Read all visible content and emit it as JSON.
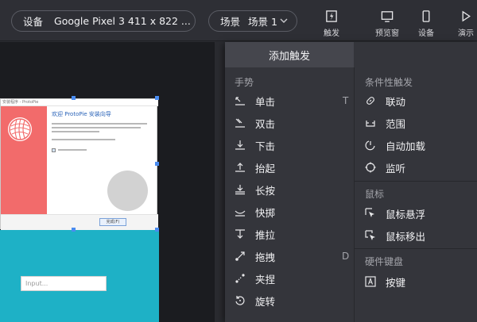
{
  "toolbar": {
    "device_label": "设备",
    "device_value": "Google Pixel 3  411 x 822 ...",
    "scene_label": "场景",
    "scene_value": "场景 1",
    "trigger_btn": "触发",
    "preview_btn": "预览窗",
    "device_btn": "设备",
    "play_btn": "演示"
  },
  "canvas": {
    "dialog_title": "安装程序 - ProtoPie",
    "dialog_heading": "欢迎 ProtoPie 安装向导",
    "dialog_ok": "完成(F)",
    "input_placeholder": "Input..."
  },
  "menu": {
    "header": "添加触发",
    "gestures": {
      "title": "手势",
      "items": [
        {
          "label": "单击",
          "icon": "tap-icon",
          "shortcut": "T"
        },
        {
          "label": "双击",
          "icon": "double-tap-icon",
          "shortcut": ""
        },
        {
          "label": "下击",
          "icon": "touch-down-icon",
          "shortcut": ""
        },
        {
          "label": "抬起",
          "icon": "touch-up-icon",
          "shortcut": ""
        },
        {
          "label": "长按",
          "icon": "long-press-icon",
          "shortcut": ""
        },
        {
          "label": "快掷",
          "icon": "fling-icon",
          "shortcut": ""
        },
        {
          "label": "推拉",
          "icon": "pull-icon",
          "shortcut": ""
        },
        {
          "label": "拖拽",
          "icon": "drag-icon",
          "shortcut": "D"
        },
        {
          "label": "夹捏",
          "icon": "pinch-icon",
          "shortcut": ""
        },
        {
          "label": "旋转",
          "icon": "rotate-icon",
          "shortcut": ""
        }
      ]
    },
    "conditional": {
      "title": "条件性触发",
      "items": [
        {
          "label": "联动",
          "icon": "link-icon"
        },
        {
          "label": "范围",
          "icon": "range-icon"
        },
        {
          "label": "自动加载",
          "icon": "auto-load-icon"
        },
        {
          "label": "监听",
          "icon": "listen-icon"
        }
      ]
    },
    "mouse": {
      "title": "鼠标",
      "items": [
        {
          "label": "鼠标悬浮",
          "icon": "mouse-hover-icon"
        },
        {
          "label": "鼠标移出",
          "icon": "mouse-out-icon"
        }
      ]
    },
    "keyboard": {
      "title": "硬件键盘",
      "items": [
        {
          "label": "按键",
          "icon": "key-icon"
        }
      ]
    }
  }
}
